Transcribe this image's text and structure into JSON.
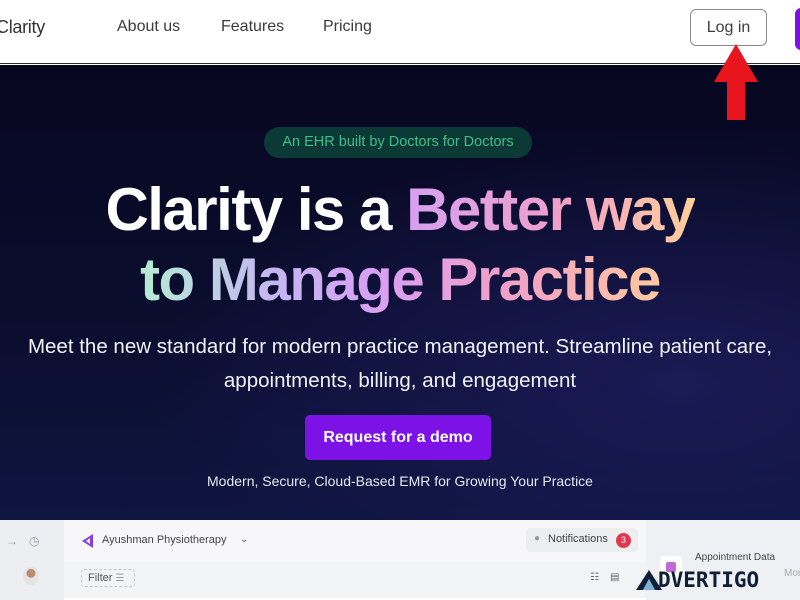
{
  "nav": {
    "logo": "Clarity",
    "links": [
      "About us",
      "Features",
      "Pricing"
    ],
    "login_label": "Log in"
  },
  "hero": {
    "badge": "An EHR built by Doctors for Doctors",
    "headline_line1_plain": "Clarity is a ",
    "headline_line1_accent": "Better way",
    "headline_line2": "to Manage Practice",
    "subtitle_line1": "Meet the new standard for modern practice management. Streamline patient care,",
    "subtitle_line2": "appointments, billing, and engagement",
    "cta_label": "Request for a demo",
    "tagline": "Modern, Secure, Cloud-Based EMR for Growing Your Practice"
  },
  "annotation": {
    "arrow_color": "#e8141e",
    "points_to": "Log in"
  },
  "dashboard_preview": {
    "organization": "Ayushman Physiotherapy",
    "notifications_label": "Notifications",
    "notifications_count": "3",
    "filter_label": "Filter",
    "side_panel_title": "Appointment Data",
    "side_panel_more": "Mor"
  },
  "watermark": {
    "text": "DVERTIGO"
  },
  "colors": {
    "brand_purple": "#7c12e6",
    "badge_green": "#3fbf86",
    "hero_bg": "#0b0d2e",
    "notification_red": "#e03850"
  }
}
